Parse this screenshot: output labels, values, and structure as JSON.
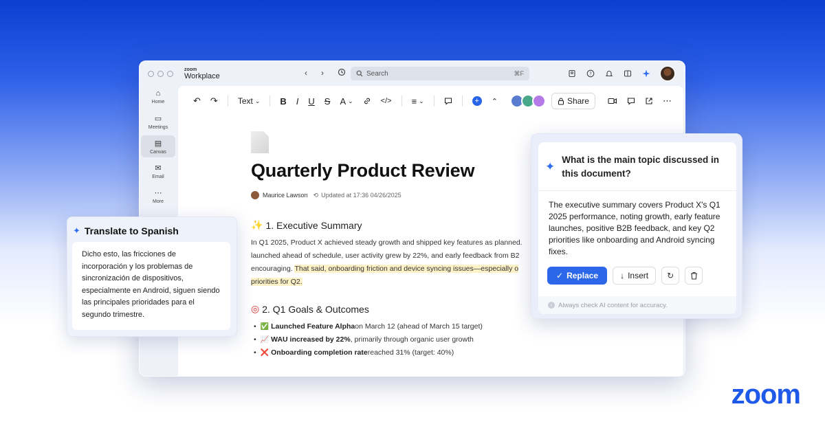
{
  "window": {
    "brand_small": "zoom",
    "brand_name": "Workplace",
    "nav_back": "‹",
    "nav_forward": "›",
    "search_placeholder": "Search",
    "search_shortcut": "⌘F"
  },
  "sidebar": {
    "items": [
      {
        "label": "Home",
        "icon": "home-icon"
      },
      {
        "label": "Meetings",
        "icon": "calendar-icon"
      },
      {
        "label": "Canvas",
        "icon": "document-icon",
        "active": true
      },
      {
        "label": "Email",
        "icon": "mail-icon"
      },
      {
        "label": "More",
        "icon": "more-icon"
      }
    ]
  },
  "toolbar": {
    "text_style": "Text",
    "share_label": "Share"
  },
  "doc": {
    "title": "Quarterly Product Review",
    "author": "Maurice Lawson",
    "updated": "Updated at 17:36  04/26/2025",
    "section1_title": "1. Executive Summary",
    "section1_lines": [
      "In Q1 2025, Product X achieved steady growth and shipped key features as planned.",
      "launched ahead of schedule, user activity grew by 22%, and early feedback from B2",
      "encouraging. ",
      "That said, onboarding friction and device syncing issues—especially o",
      "priorities for Q2."
    ],
    "section2_title": "2. Q1 Goals & Outcomes",
    "bullets": [
      {
        "bold": "Launched Feature Alpha",
        "rest": " on March 12 (ahead of March 15 target)"
      },
      {
        "bold": "WAU increased by 22%",
        "rest": ", primarily through organic user growth"
      },
      {
        "bold": "Onboarding completion rate",
        "rest": " reached 31% (target: 40%)"
      }
    ]
  },
  "translate": {
    "title": "Translate to Spanish",
    "body": "Dicho esto, las fricciones de incorporación y los problemas de sincronización de dispositivos, especialmente en Android, siguen siendo las principales prioridades para el segundo trimestre."
  },
  "ai": {
    "question": "What is the main topic discussed in this document?",
    "answer": "The executive summary covers Product X's Q1 2025 performance, noting growth, early feature launches, positive B2B feedback, and key Q2 priorities like onboarding and Android syncing fixes.",
    "replace_label": "Replace",
    "insert_label": "Insert",
    "footer": "Always check AI content for accuracy."
  },
  "logo": "zoom"
}
